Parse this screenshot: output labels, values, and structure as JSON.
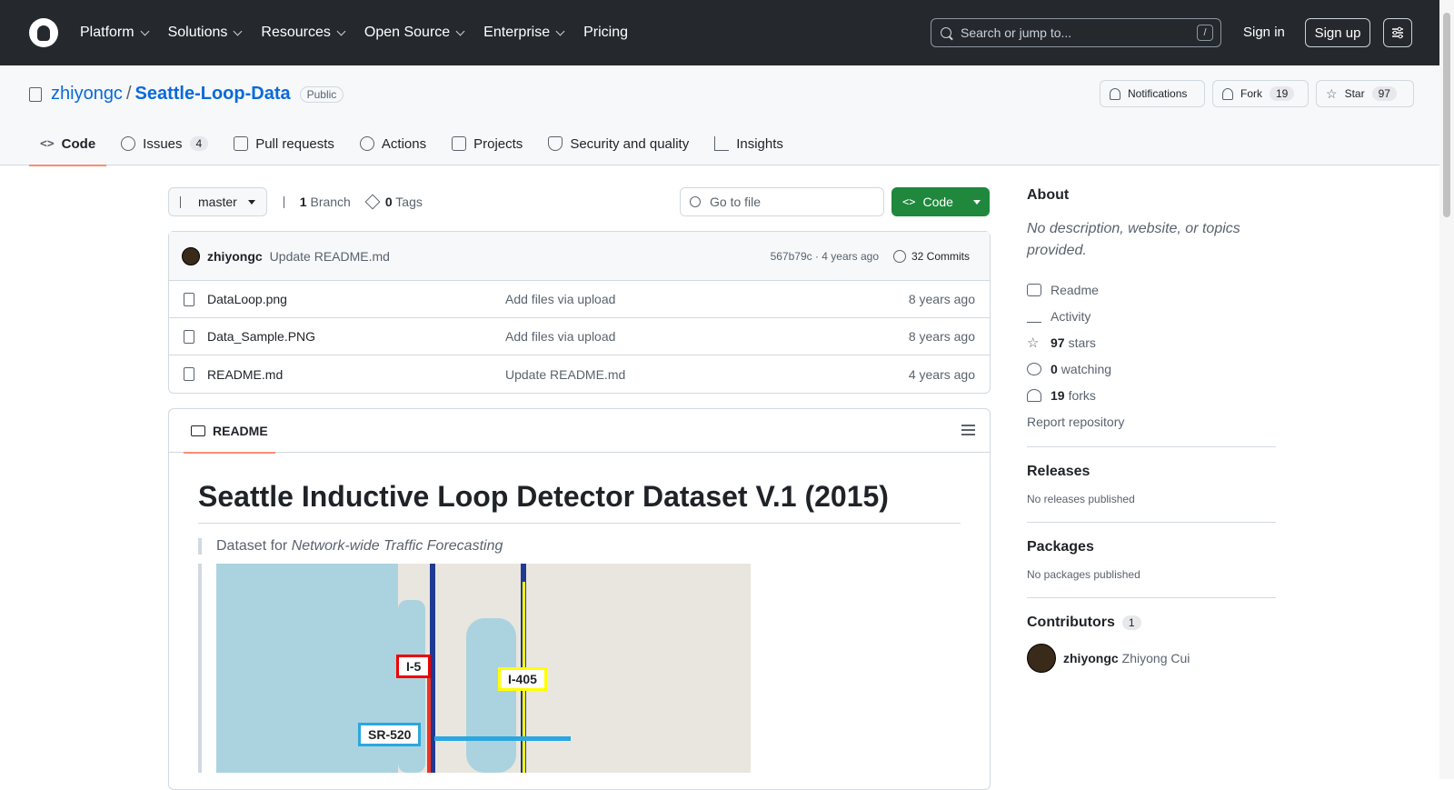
{
  "nav": {
    "items": [
      "Platform",
      "Solutions",
      "Resources",
      "Open Source",
      "Enterprise",
      "Pricing"
    ],
    "search_placeholder": "Search or jump to...",
    "slash": "/",
    "signin": "Sign in",
    "signup": "Sign up"
  },
  "repo": {
    "owner": "zhiyongc",
    "sep": "/",
    "name": "Seattle-Loop-Data",
    "visibility": "Public",
    "notifications": "Notifications",
    "fork_label": "Fork",
    "fork_count": "19",
    "star_label": "Star",
    "star_count": "97"
  },
  "tabs": [
    {
      "label": "Code",
      "count": ""
    },
    {
      "label": "Issues",
      "count": "4"
    },
    {
      "label": "Pull requests",
      "count": ""
    },
    {
      "label": "Actions",
      "count": ""
    },
    {
      "label": "Projects",
      "count": ""
    },
    {
      "label": "Security and quality",
      "count": ""
    },
    {
      "label": "Insights",
      "count": ""
    }
  ],
  "toolbar": {
    "branch": "master",
    "branch_count": "1",
    "branch_label": "Branch",
    "tag_count": "0",
    "tag_label": "Tags",
    "goto_placeholder": "Go to file",
    "code_label": "Code"
  },
  "commit": {
    "user": "zhiyongc",
    "message": "Update README.md",
    "hash_age": "567b79c · 4 years ago",
    "commits": "32 Commits"
  },
  "files": [
    {
      "name": "DataLoop.png",
      "commit": "Add files via upload",
      "age": "8 years ago"
    },
    {
      "name": "Data_Sample.PNG",
      "commit": "Add files via upload",
      "age": "8 years ago"
    },
    {
      "name": "README.md",
      "commit": "Update README.md",
      "age": "4 years ago"
    }
  ],
  "readme": {
    "tab": "README",
    "title": "Seattle Inductive Loop Detector Dataset V.1 (2015)",
    "quote_prefix": "Dataset for ",
    "quote_em": "Network-wide Traffic Forecasting",
    "map_labels": [
      "I-5",
      "I-405",
      "SR-520"
    ]
  },
  "about": {
    "title": "About",
    "description": "No description, website, or topics provided.",
    "readme": "Readme",
    "activity": "Activity",
    "stars_count": "97",
    "stars_label": "stars",
    "watching_count": "0",
    "watching_label": "watching",
    "forks_count": "19",
    "forks_label": "forks",
    "report": "Report repository"
  },
  "releases": {
    "title": "Releases",
    "text": "No releases published"
  },
  "packages": {
    "title": "Packages",
    "text": "No packages published"
  },
  "contributors": {
    "title": "Contributors",
    "count": "1",
    "user": "zhiyongc",
    "fullname": "Zhiyong Cui"
  }
}
